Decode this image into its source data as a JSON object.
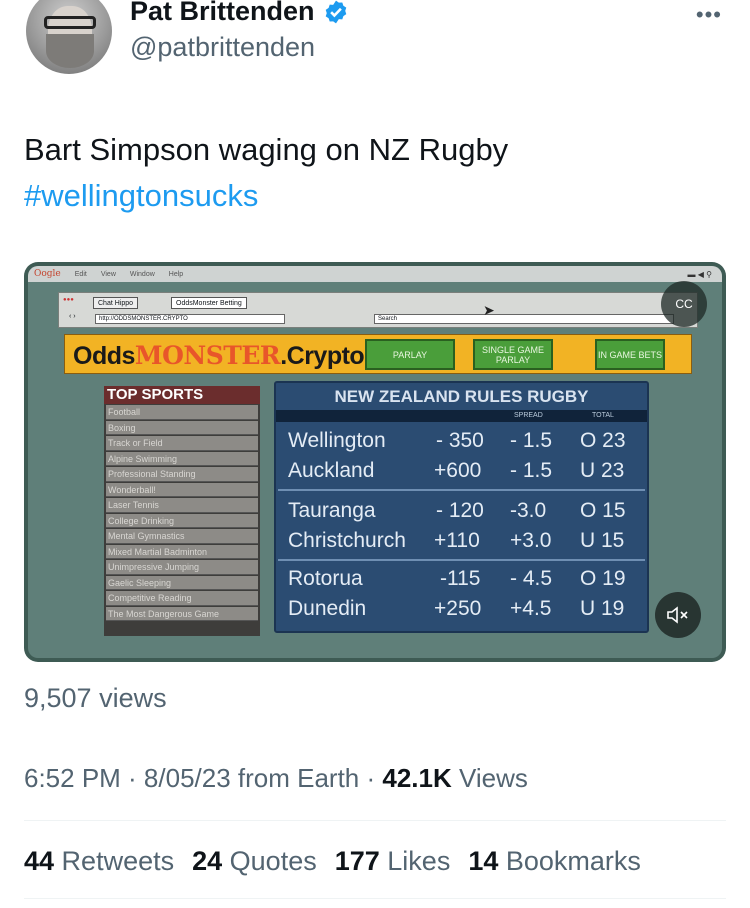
{
  "author": {
    "name": "Pat Brittenden",
    "handle": "@patbrittenden",
    "verified_icon": "verified-badge-icon"
  },
  "tweet": {
    "text": "Bart Simpson waging on NZ Rugby",
    "hashtag": "#wellingtonsucks"
  },
  "video": {
    "menu_logo": "Oogle",
    "menu_items": [
      "Edit",
      "View",
      "Window",
      "Help"
    ],
    "tabs": [
      "Chat Hippo",
      "OddsMonster Betting"
    ],
    "url": "http://ODDSMONSTER.CRYPTO",
    "search_label": "Search",
    "site": {
      "logo_left": "Odds",
      "logo_mid": "MONSTER",
      "logo_right": ".Crypto"
    },
    "buttons": {
      "parlay": "PARLAY",
      "single_game": "SINGLE GAME PARLAY",
      "in_game": "IN GAME BETS"
    },
    "sidebar": {
      "title": "TOP SPORTS",
      "items": [
        "Football",
        "Boxing",
        "Track or Field",
        "Alpine Swimming",
        "Professional Standing",
        "Wonderball!",
        "Laser Tennis",
        "College Drinking",
        "Mental Gymnastics",
        "Mixed Martial Badminton",
        "Unimpressive Jumping",
        "Gaelic Sleeping",
        "Competitive Reading",
        "The Most Dangerous Game"
      ]
    },
    "board": {
      "title": "NEW ZEALAND RULES RUGBY",
      "head_spread": "SPREAD",
      "head_total": "TOTAL",
      "rows": [
        {
          "team": "Wellington",
          "line": "- 350",
          "spread": "- 1.5",
          "total": "O 23"
        },
        {
          "team": "Auckland",
          "line": "+600",
          "spread": "- 1.5",
          "total": "U 23"
        },
        {
          "team": "Tauranga",
          "line": "- 120",
          "spread": "-3.0",
          "total": "O 15"
        },
        {
          "team": "Christchurch",
          "line": "+110",
          "spread": "+3.0",
          "total": "U 15"
        },
        {
          "team": "Rotorua",
          "line": "-115",
          "spread": "- 4.5",
          "total": "O 19"
        },
        {
          "team": "Dunedin",
          "line": "+250",
          "spread": "+4.5",
          "total": "U 19"
        }
      ]
    },
    "cc_label": "CC",
    "mute_icon": "speaker-muted-icon"
  },
  "views_count": "9,507 views",
  "meta": {
    "time": "6:52 PM · 8/05/23 from Earth · ",
    "views_num": "42.1K",
    "views_label": " Views"
  },
  "stats": {
    "retweets_num": "44",
    "retweets_label": " Retweets",
    "quotes_num": "24",
    "quotes_label": " Quotes",
    "likes_num": "177",
    "likes_label": " Likes",
    "bookmarks_num": "14",
    "bookmarks_label": " Bookmarks"
  }
}
